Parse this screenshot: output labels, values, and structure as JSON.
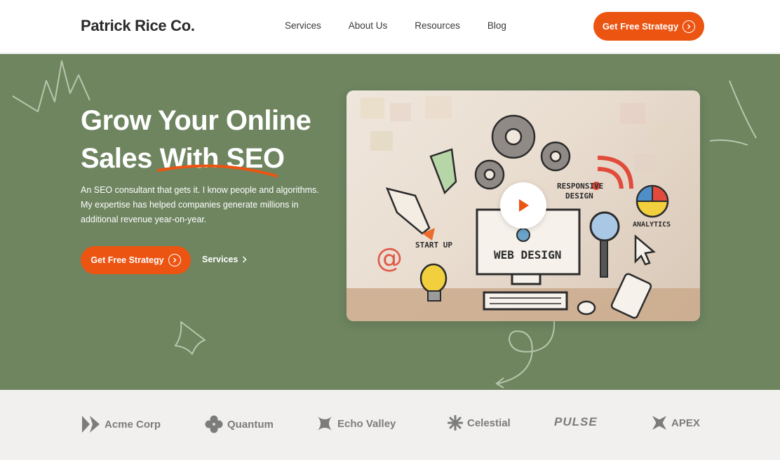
{
  "header": {
    "logo": "Patrick Rice Co.",
    "nav": [
      "Services",
      "About Us",
      "Resources",
      "Blog"
    ],
    "cta": "Get Free Strategy"
  },
  "hero": {
    "title_line1": "Grow Your Online",
    "title_line2": "Sales With SEO",
    "description": "An SEO consultant that gets it. I know people and algorithms. My expertise has helped companies generate millions in additional revenue year-on-year.",
    "cta": "Get Free Strategy",
    "secondary_link": "Services",
    "video": {
      "labels": [
        "RESPONSIVE DESIGN",
        "ANALYTICS",
        "START UP",
        "WEB DESIGN"
      ]
    }
  },
  "logos": [
    "Acme Corp",
    "Quantum",
    "Echo Valley",
    "Celestial",
    "PULSE",
    "APEX"
  ],
  "colors": {
    "accent": "#ec5412",
    "hero_bg": "#6e8560",
    "logo_strip_bg": "#f1f0ee"
  },
  "icons": [
    "chevron-right-circle-icon",
    "play-icon",
    "chevron-right-icon"
  ]
}
